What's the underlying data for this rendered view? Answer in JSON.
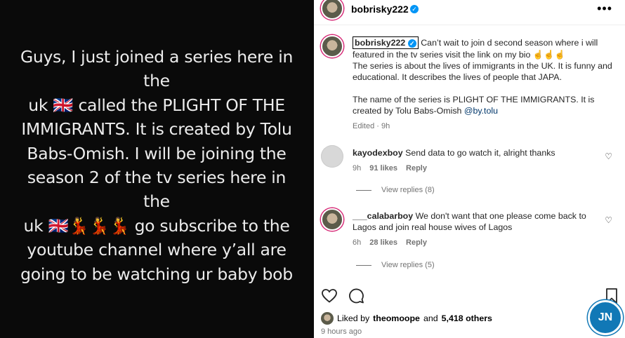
{
  "story": {
    "lines": [
      "Guys, I just joined a series here in the",
      "uk 🇬🇧 called the PLIGHT OF THE",
      "IMMIGRANTS. It is created by Tolu",
      "Babs-Omish. I will be joining the",
      "season 2 of the tv series here in the",
      "uk 🇬🇧💃💃💃 go subscribe to the",
      "youtube channel where y’all are",
      "going to be  watching ur baby bob"
    ]
  },
  "header": {
    "username": "bobrisky222",
    "more": "•••"
  },
  "caption": {
    "username": "bobrisky222",
    "line1": " Can’t wait to join d second season where i will featured in the tv series visit the link on my bio ☝️☝️☝️",
    "line2": "The series is about the lives of immigrants in the UK. It is funny and educational. It describes the lives of people that JAPA.",
    "line3": "The name of the series is PLIGHT OF THE IMMIGRANTS. It is created by Tolu Babs-Omish ",
    "mention": "@by.tolu",
    "meta": "Edited · 9h"
  },
  "comments": [
    {
      "username": "kayodexboy",
      "text": "Send data to go watch it, alright thanks",
      "time": "9h",
      "likes": "91 likes",
      "reply": "Reply",
      "view_replies": "View replies (8)"
    },
    {
      "username": "___calabarboy",
      "text": "We don't want that one please come back to Lagos and join real house wives of Lagos",
      "time": "6h",
      "likes": "28 likes",
      "reply": "Reply",
      "view_replies": "View replies (5)"
    }
  ],
  "likes": {
    "prefix": "Liked by ",
    "user": "theomoope",
    "middle": " and ",
    "count": "5,418 others"
  },
  "time_ago": "9 hours ago",
  "watermark": "JN",
  "colors": {
    "verified": "#0095f6",
    "link": "#00376b",
    "watermark": "#1178b6"
  }
}
